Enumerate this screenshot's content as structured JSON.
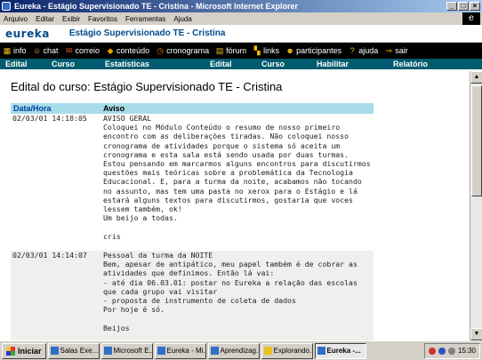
{
  "window": {
    "title": "Eureka - Estágio Supervisionado TE - Cristina - Microsoft Internet Explorer"
  },
  "menu": [
    "Arquivo",
    "Editar",
    "Exibir",
    "Favoritos",
    "Ferramentas",
    "Ajuda"
  ],
  "site": {
    "logo": "eureka",
    "course_title": "Estágio Supervisionado TE - Cristina"
  },
  "toolbar": [
    {
      "label": "info",
      "icon": "info-icon",
      "color": "#e8c020",
      "glyph": "▦"
    },
    {
      "label": "chat",
      "icon": "chat-icon",
      "color": "#f0b040",
      "glyph": "☺"
    },
    {
      "label": "correio",
      "icon": "mail-icon",
      "color": "#e06020",
      "glyph": "✉"
    },
    {
      "label": "conteúdo",
      "icon": "content-icon",
      "color": "#f0a000",
      "glyph": "◆"
    },
    {
      "label": "cronograma",
      "icon": "schedule-icon",
      "color": "#f08000",
      "glyph": "◷"
    },
    {
      "label": "fórum",
      "icon": "forum-icon",
      "color": "#e8c020",
      "glyph": "▤"
    },
    {
      "label": "links",
      "icon": "links-icon",
      "color": "#f0c000",
      "glyph": "▚"
    },
    {
      "label": "participantes",
      "icon": "participants-icon",
      "color": "#e8c020",
      "glyph": "☻"
    },
    {
      "label": "ajuda",
      "icon": "help-icon",
      "color": "#f0c000",
      "glyph": "?"
    },
    {
      "label": "sair",
      "icon": "exit-icon",
      "color": "#f0a000",
      "glyph": "⇒"
    }
  ],
  "nav": [
    "Edital",
    "Curso",
    "Estatísticas",
    "Edital",
    "Curso",
    "Habilitar",
    "Relatório"
  ],
  "page": {
    "heading": "Edital do curso:  Estágio Supervisionado TE - Cristina",
    "col_datetime": "Data/Hora",
    "col_notice": "Aviso"
  },
  "notices": [
    {
      "datetime": "02/03/01 14:18:05",
      "text": "AVISO GERAL\nColoquei no Módulo Conteúdo o resumo de nosso primeiro encontro com as deliberações tiradas. Não coloquei nosso cronograma de atividades porque o sistema só aceita um cronograma e esta sala está sendo usada por duas turmas.\nEstou pensando em marcarmos alguns encontros para discutirmos questões mais teóricas sobre a problemática da Tecnologia Educacional. E, para a turma da noite, acabamos não tocando no assunto, mas tem uma pasta no xerox para o Estágio e lá estará alguns textos para discutirmos, gostaria que voces lessem também, ok!\nUm beijo a todas.\n\ncris"
    },
    {
      "datetime": "02/03/01 14:14:07",
      "text": "Pessoal da turma da NOITE\nBem, apesar de antipático, meu papel também é de cobrar as atividades que definimos. Então lá vai:\n- até dia 06.03.01: postar no Eureka a relação das escolas que cada grupo vai visitar\n- proposta de instrumento de coleta de dados\nPor hoje é só.\n\nBeijos"
    }
  ],
  "taskbar": {
    "start": "Iniciar",
    "tasks": [
      "Salas Exe...",
      "Microsoft E...",
      "Eureka - Mi...",
      "Aprendizag...",
      "Explorando...",
      "Eureka -..."
    ],
    "clock": "15:30"
  }
}
